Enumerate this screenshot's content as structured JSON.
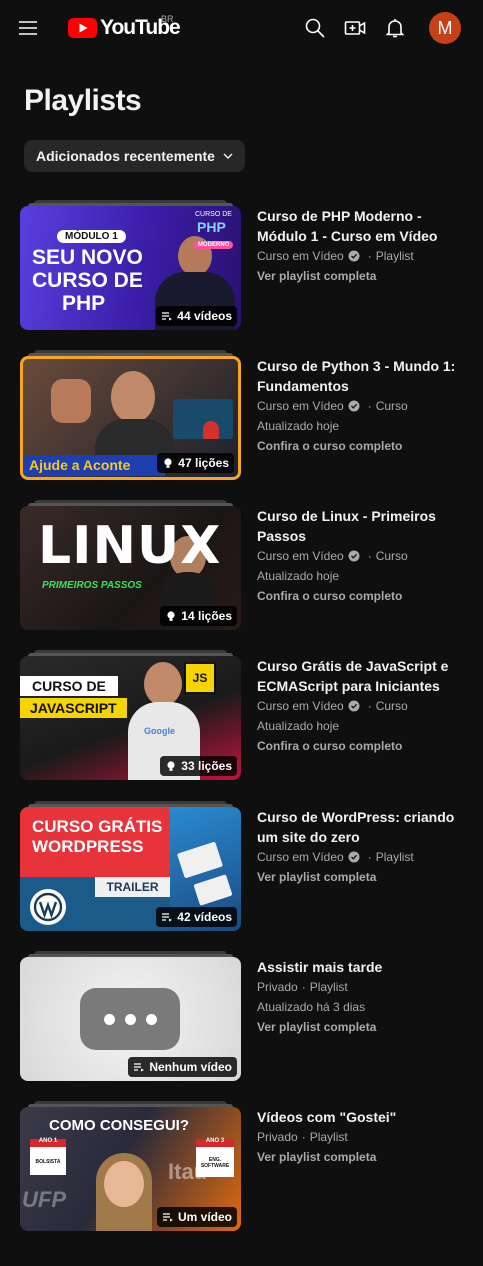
{
  "header": {
    "logo_text": "YouTube",
    "country_code": "BR",
    "avatar_letter": "M",
    "brand_color": "#ff0000"
  },
  "page": {
    "title": "Playlists",
    "sort_label": "Adicionados recentemente"
  },
  "playlists": [
    {
      "title": "Curso de PHP Moderno - Módulo 1 - Curso em Vídeo",
      "channel": "Curso em Vídeo",
      "verified": true,
      "type": "Playlist",
      "updated": "",
      "link": "Ver playlist completa",
      "badge": "44 vídeos",
      "badge_icon": "playlist-icon",
      "thumb": {
        "line1": "MÓDULO 1",
        "line2": "SEU NOVO",
        "line3": "CURSO DE",
        "line4": "PHP",
        "corner_top": "CURSO DE",
        "corner_mid": "PHP",
        "corner_bottom": "MODERNO"
      }
    },
    {
      "title": "Curso de Python 3 - Mundo 1: Fundamentos",
      "channel": "Curso em Vídeo",
      "verified": true,
      "type": "Curso",
      "updated": "Atualizado hoje",
      "link": "Confira o curso completo",
      "badge": "47 lições",
      "badge_icon": "lightbulb-icon",
      "thumb": {
        "caption": "Ajude a Aconte"
      }
    },
    {
      "title": "Curso de Linux - Primeiros Passos",
      "channel": "Curso em Vídeo",
      "verified": true,
      "type": "Curso",
      "updated": "Atualizado hoje",
      "link": "Confira o curso completo",
      "badge": "14 lições",
      "badge_icon": "lightbulb-icon",
      "thumb": {
        "big": "LINUX",
        "sub": "PRIMEIROS PASSOS"
      }
    },
    {
      "title": "Curso Grátis de JavaScript e ECMAScript para Iniciantes",
      "channel": "Curso em Vídeo",
      "verified": true,
      "type": "Curso",
      "updated": "Atualizado hoje",
      "link": "Confira o curso completo",
      "badge": "33 lições",
      "badge_icon": "lightbulb-icon",
      "thumb": {
        "line1": "CURSO DE",
        "line2": "JAVASCRIPT",
        "logo": "JS",
        "shirt": "Google"
      }
    },
    {
      "title": "Curso de WordPress: criando um site do zero",
      "channel": "Curso em Vídeo",
      "verified": true,
      "type": "Playlist",
      "updated": "",
      "link": "Ver playlist completa",
      "badge": "42 vídeos",
      "badge_icon": "playlist-icon",
      "thumb": {
        "line1": "CURSO GRÁTIS",
        "line2": "WORDPRESS",
        "trailer": "TRAILER"
      }
    },
    {
      "title": "Assistir mais tarde",
      "channel": "Privado",
      "verified": false,
      "type": "Playlist",
      "updated": "Atualizado há 3 dias",
      "link": "Ver playlist completa",
      "badge": "Nenhum vídeo",
      "badge_icon": "playlist-icon",
      "thumb": {}
    },
    {
      "title": "Vídeos com \"Gostei\"",
      "channel": "Privado",
      "verified": false,
      "type": "Playlist",
      "updated": "",
      "link": "Ver playlist completa",
      "badge": "Um vídeo",
      "badge_icon": "playlist-icon",
      "thumb": {
        "headline": "COMO CONSEGUI?",
        "left_tag_top": "ANO 1",
        "left_tag_bottom": "BOLSISTA",
        "right_tag_top": "ANO 3",
        "right_tag_bottom": "ENG. SOFTWARE",
        "bg_left": "UFP",
        "bg_right": "Itaú"
      }
    }
  ]
}
